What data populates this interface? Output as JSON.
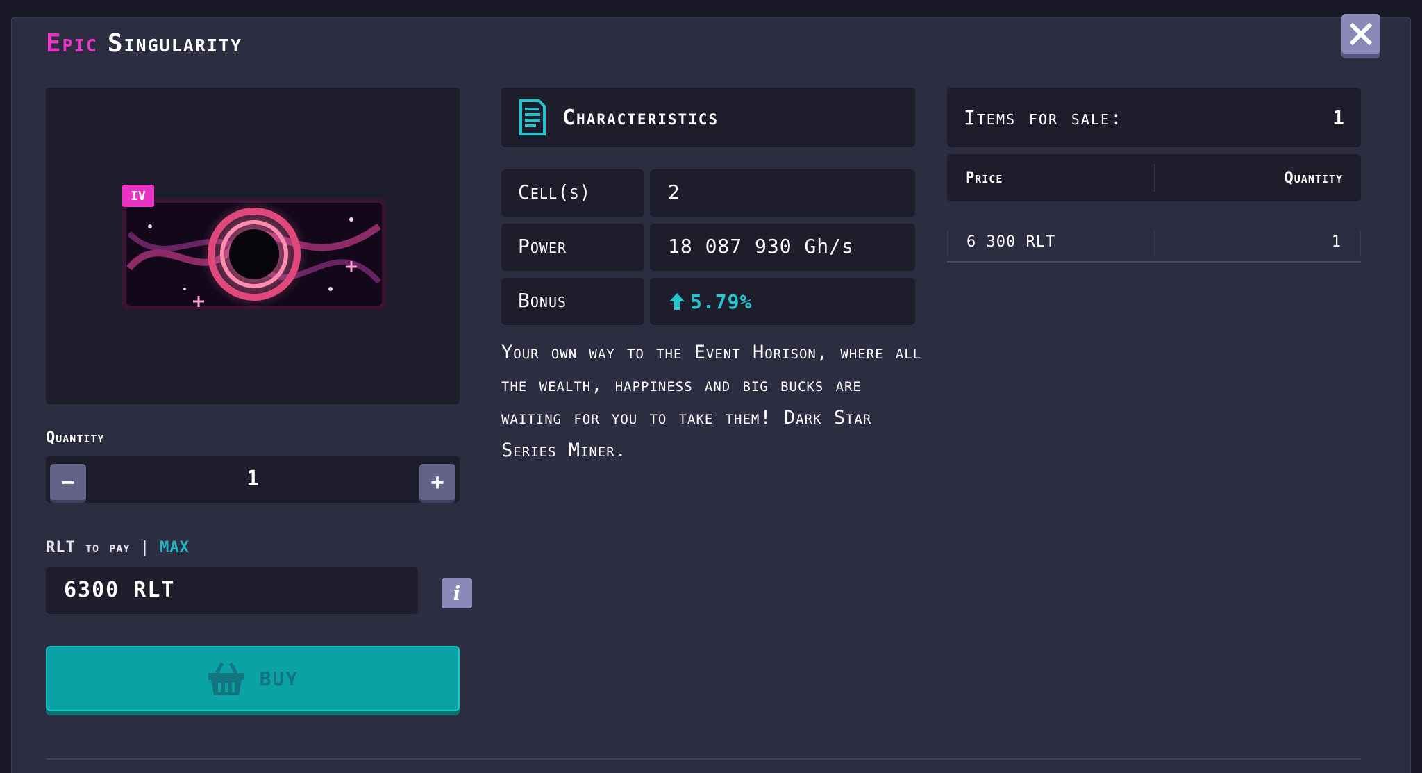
{
  "title": {
    "rarity": "Epic",
    "name": "Singularity"
  },
  "miner": {
    "level_badge": "IV",
    "image": "singularity-miner-art"
  },
  "quantity": {
    "label": "Quantity",
    "value": "1",
    "minus": "−",
    "plus": "+"
  },
  "payment": {
    "label": "RLT",
    "label_suffix": "to pay",
    "separator": "|",
    "max_label": "MAX",
    "value": "6300 RLT",
    "info": "i"
  },
  "buy_button": {
    "label": "BUY",
    "icon": "basket-icon"
  },
  "characteristics": {
    "title": "Characteristics",
    "icon": "document-icon",
    "rows": [
      {
        "key": "Cell(s)",
        "value": "2"
      },
      {
        "key": "Power",
        "value": "18 087 930 Gh/s"
      },
      {
        "key": "Bonus",
        "value": "5.79%"
      }
    ]
  },
  "description": "Your own way to the Event Horison, where all the wealth, happiness and big bucks are waiting for you to take them! Dark Star Series Miner.",
  "sale": {
    "label": "Items for sale:",
    "count": "1",
    "columns": {
      "price": "Price",
      "quantity": "Quantity"
    },
    "offers": [
      {
        "price": "6 300 RLT",
        "quantity": "1"
      }
    ]
  },
  "colors": {
    "background": "#191927",
    "modal": "#2c2d41",
    "panel": "#1d1d2c",
    "rarity": "#e933c4",
    "accent": "#22b6c3",
    "buy": "#0aa2a4"
  }
}
